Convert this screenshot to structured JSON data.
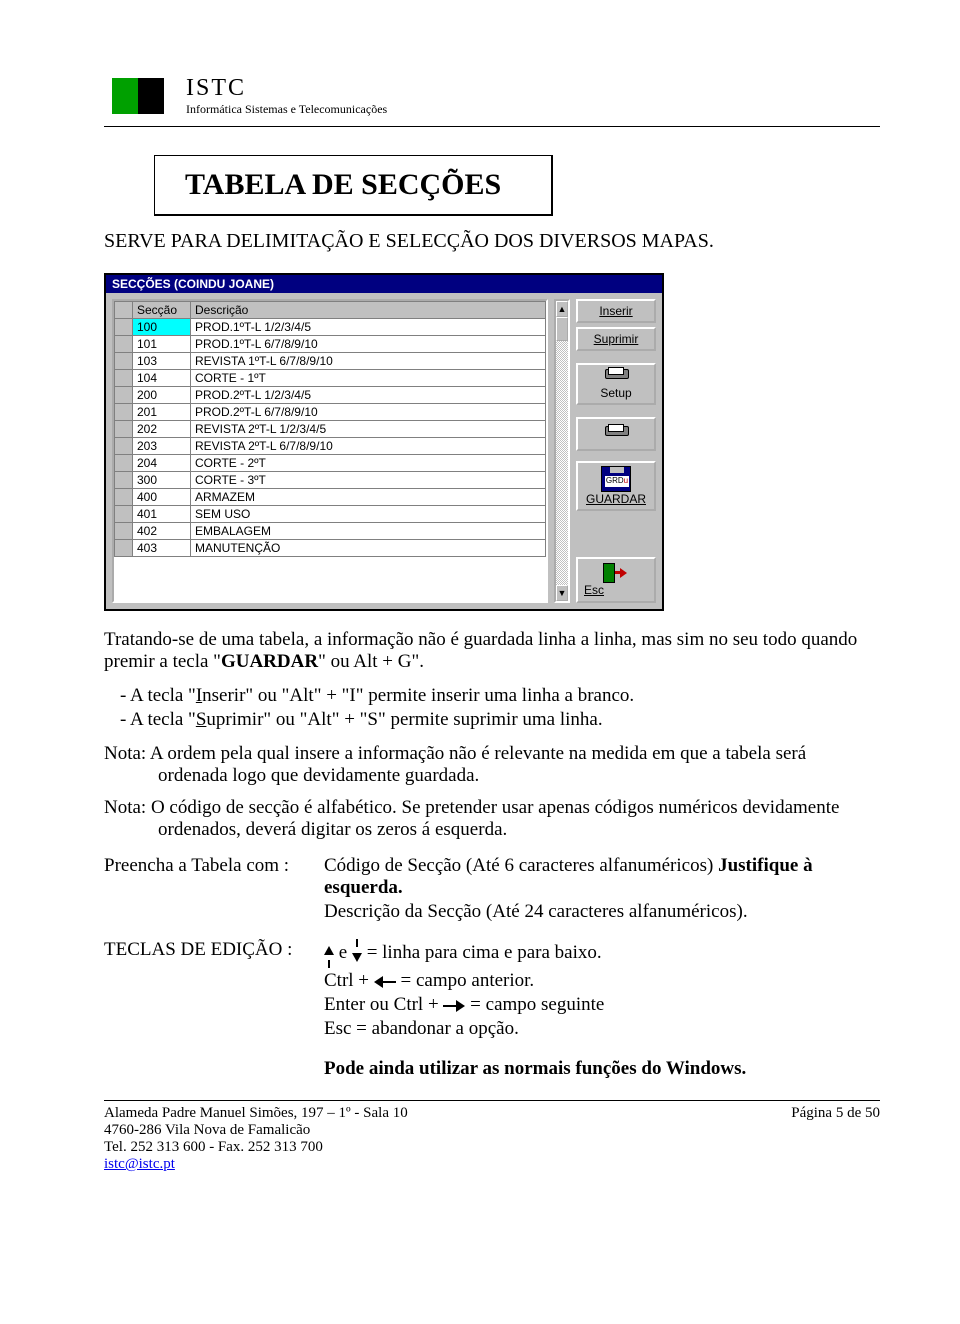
{
  "header": {
    "abbr": "ISTC",
    "tagline": "Informática Sistemas e Telecomunicações"
  },
  "title": "TABELA DE SECÇÕES",
  "subtitle": "SERVE PARA DELIMITAÇÃO E SELECÇÃO DOS DIVERSOS MAPAS.",
  "window": {
    "title": "SECÇÕES (COINDU JOANE)",
    "headers": {
      "c1": "Secção",
      "c2": "Descrição"
    },
    "rows": [
      {
        "c1": "100",
        "c2": "PROD.1ºT-L 1/2/3/4/5",
        "sel": true
      },
      {
        "c1": "101",
        "c2": "PROD.1ºT-L 6/7/8/9/10"
      },
      {
        "c1": "103",
        "c2": "REVISTA 1ºT-L 6/7/8/9/10"
      },
      {
        "c1": "104",
        "c2": "CORTE - 1ºT"
      },
      {
        "c1": "200",
        "c2": "PROD.2ºT-L 1/2/3/4/5"
      },
      {
        "c1": "201",
        "c2": "PROD.2ºT-L 6/7/8/9/10"
      },
      {
        "c1": "202",
        "c2": "REVISTA 2ºT-L 1/2/3/4/5"
      },
      {
        "c1": "203",
        "c2": "REVISTA 2ºT-L 6/7/8/9/10"
      },
      {
        "c1": "204",
        "c2": "CORTE - 2ºT"
      },
      {
        "c1": "300",
        "c2": "CORTE - 3ºT"
      },
      {
        "c1": "400",
        "c2": "ARMAZEM"
      },
      {
        "c1": "401",
        "c2": "SEM USO"
      },
      {
        "c1": "402",
        "c2": "EMBALAGEM"
      },
      {
        "c1": "403",
        "c2": "MANUTENÇÃO"
      }
    ],
    "buttons": {
      "inserir": "Inserir",
      "suprimir": "Suprimir",
      "setup": "Setup",
      "guardar_label": "GRD",
      "guardar": "GUARDAR",
      "esc": "Esc"
    }
  },
  "para1a": "Tratando-se de uma tabela, a informação não é guardada linha a linha, mas sim no seu todo quando premir a tecla \"",
  "para1b": "GUARDAR",
  "para1c": "\" ou Alt + G\".",
  "bullets": {
    "b1a": "A tecla \"",
    "b1b": "I",
    "b1c": "nserir\" ou \"Alt\" + \"I\" permite inserir uma linha a branco.",
    "b2a": "A tecla \"",
    "b2b": "S",
    "b2c": "uprimir\" ou \"Alt\" + \"S\" permite suprimir uma linha."
  },
  "note1": "Nota: A ordem pela qual insere a informação não é relevante na medida em que a tabela será ordenada logo que devidamente guardada.",
  "note2": "Nota: O código de secção é alfabético. Se pretender usar apenas códigos numéricos devidamente ordenados, deverá digitar os zeros á esquerda.",
  "fill": {
    "label": "Preencha a Tabela com :",
    "l1a": "Código de Secção (Até 6 caracteres alfanuméricos)  ",
    "l1b": "Justifique à esquerda.",
    "l2": "Descrição da Secção (Até 24 caracteres alfanuméricos)."
  },
  "keys": {
    "label": "TECLAS DE EDIÇÃO :",
    "l1a": "  e  ",
    "l1b": "  = linha para cima e para baixo.",
    "l2a": "Ctrl + ",
    "l2b": "   = campo anterior.",
    "l3a": "Enter ou Ctrl +   ",
    "l3b": "   = campo seguinte",
    "l4": "Esc =  abandonar a opção.",
    "l5": "Pode ainda utilizar as normais funções do Windows."
  },
  "footer": {
    "addr1": "Alameda Padre Manuel Simões, 197 – 1º - Sala 10",
    "page": "Página 5 de 50",
    "addr2": "4760-286 Vila Nova de Famalicão",
    "tel": "Tel.  252 313 600  -  Fax.  252 313 700",
    "mail": "istc@istc.pt"
  }
}
